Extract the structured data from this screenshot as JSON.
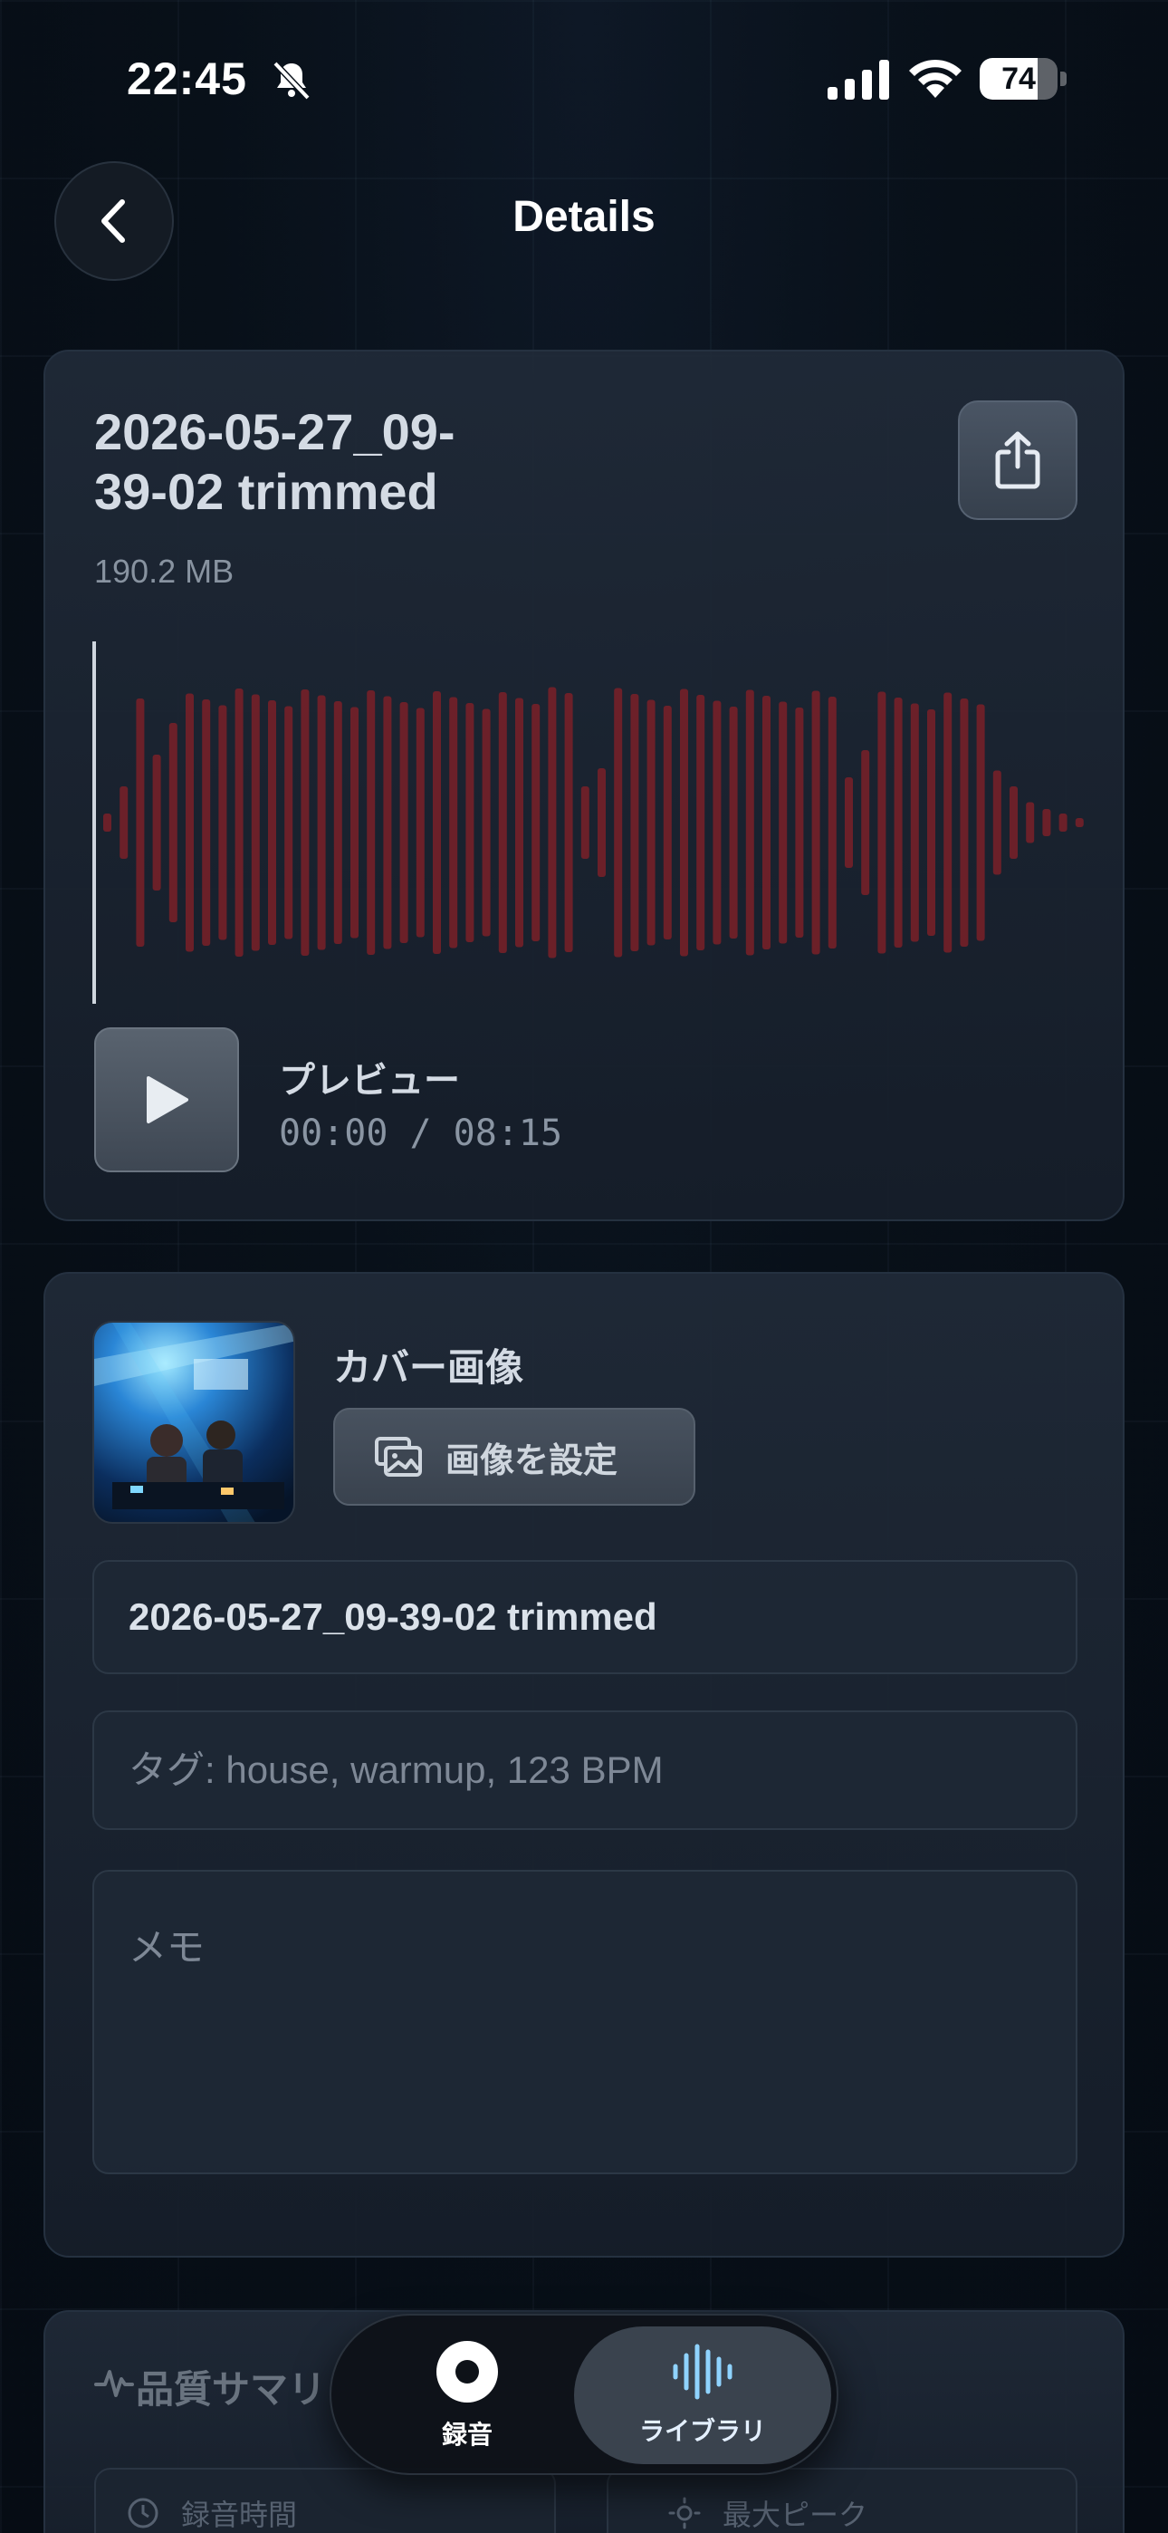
{
  "status_bar": {
    "time": "22:45",
    "battery": "74",
    "battery_level": 0.74
  },
  "nav": {
    "back_icon": "chevron-left-icon",
    "title": "Details"
  },
  "file": {
    "title_line1": "2026-05-27_09-",
    "title_line2": "39-02 trimmed",
    "size": "190.2 MB",
    "share_icon": "share-icon"
  },
  "player": {
    "label": "プレビュー",
    "time": "00:00 / 08:15",
    "position": 0,
    "waveform_color": "#7a2028"
  },
  "cover": {
    "label": "カバー画像",
    "set_button": "画像を設定"
  },
  "fields": {
    "name_value": "2026-05-27_09-39-02 trimmed",
    "tags_placeholder": "タグ: house, warmup, 123 BPM",
    "memo_placeholder": "メモ"
  },
  "summary": {
    "title": "品質サマリ",
    "left_label": "録音時間",
    "right_label": "最大ピーク"
  },
  "tabbar": {
    "items": [
      {
        "label": "録音",
        "icon": "record-icon",
        "selected": false
      },
      {
        "label": "ライブラリ",
        "icon": "waveform-icon",
        "selected": true
      }
    ]
  }
}
